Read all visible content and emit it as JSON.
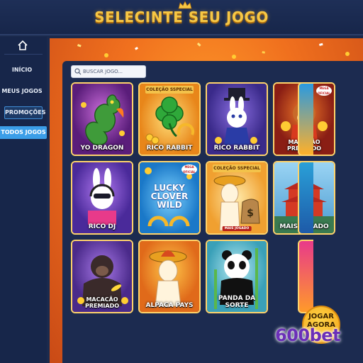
{
  "header": {
    "title": "SELECINTE SEU JOGO"
  },
  "sidebar": {
    "items": [
      {
        "label": "INÍCIO"
      },
      {
        "label": "MEUS JOGOS"
      },
      {
        "label": "PROMOÇÕES"
      },
      {
        "label": "TODOS JOGOS"
      }
    ]
  },
  "search": {
    "placeholder": "BUSCAR JOGO..."
  },
  "games": [
    {
      "title": "YO DRAGON"
    },
    {
      "title": "RICO RABBIT",
      "ribbon": "COLEÇÃO SSPECIAL"
    },
    {
      "title": "RICO RABBIT"
    },
    {
      "title": "MACACÃO PREMIADO",
      "badge": "MEGA OFICIAL"
    },
    {
      "title": "RICO DJ"
    },
    {
      "title": "LUCKY CLOVER WILD",
      "badge": "MEGA OFICIAL"
    },
    {
      "title": "",
      "ribbon": "COLEÇÃO SSPECIAL",
      "badge": "MAIS JOGADO"
    },
    {
      "title": "MAIS JOGADO"
    },
    {
      "title": "MACACÃO PREMIADO"
    },
    {
      "title": "ALPACA PAYS"
    },
    {
      "title": "PANDA DA SORTE"
    }
  ],
  "play_button": {
    "label": "JOGAR AGORA"
  },
  "brand": "600bet"
}
